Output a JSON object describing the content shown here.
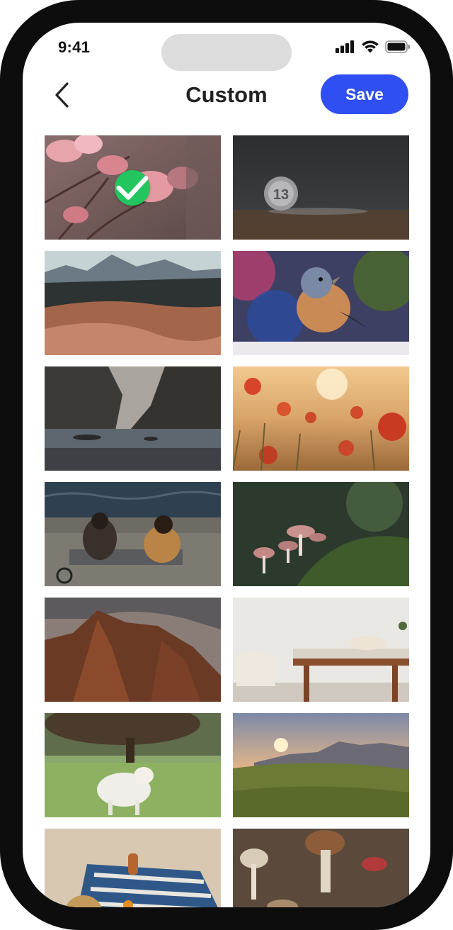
{
  "status_bar": {
    "time": "9:41",
    "icons": [
      "cellular-signal-icon",
      "wifi-icon",
      "battery-icon"
    ]
  },
  "header": {
    "title": "Custom",
    "back_icon": "chevron-left-icon",
    "save_label": "Save"
  },
  "colors": {
    "accent": "#2f4ff2",
    "selected_check": "#22c55e"
  },
  "grid": {
    "selected_index": 0,
    "photos": [
      {
        "subject": "pink blossoms",
        "selected": true
      },
      {
        "subject": "coin on dark table",
        "selected": false
      },
      {
        "subject": "desert dunes and mountains",
        "selected": false
      },
      {
        "subject": "small bird on snow",
        "selected": false
      },
      {
        "subject": "rocky sea cove",
        "selected": false
      },
      {
        "subject": "poppy field at sunset",
        "selected": false
      },
      {
        "subject": "two people sitting by water",
        "selected": false
      },
      {
        "subject": "mushrooms on moss",
        "selected": false
      },
      {
        "subject": "rocky mountain peak",
        "selected": false
      },
      {
        "subject": "dining table with chairs",
        "selected": false
      },
      {
        "subject": "lamb in green field",
        "selected": false
      },
      {
        "subject": "mountain valley at sunrise",
        "selected": false
      },
      {
        "subject": "picnic blanket on sand",
        "selected": false
      },
      {
        "subject": "mushrooms on wooden table",
        "selected": false
      }
    ]
  }
}
